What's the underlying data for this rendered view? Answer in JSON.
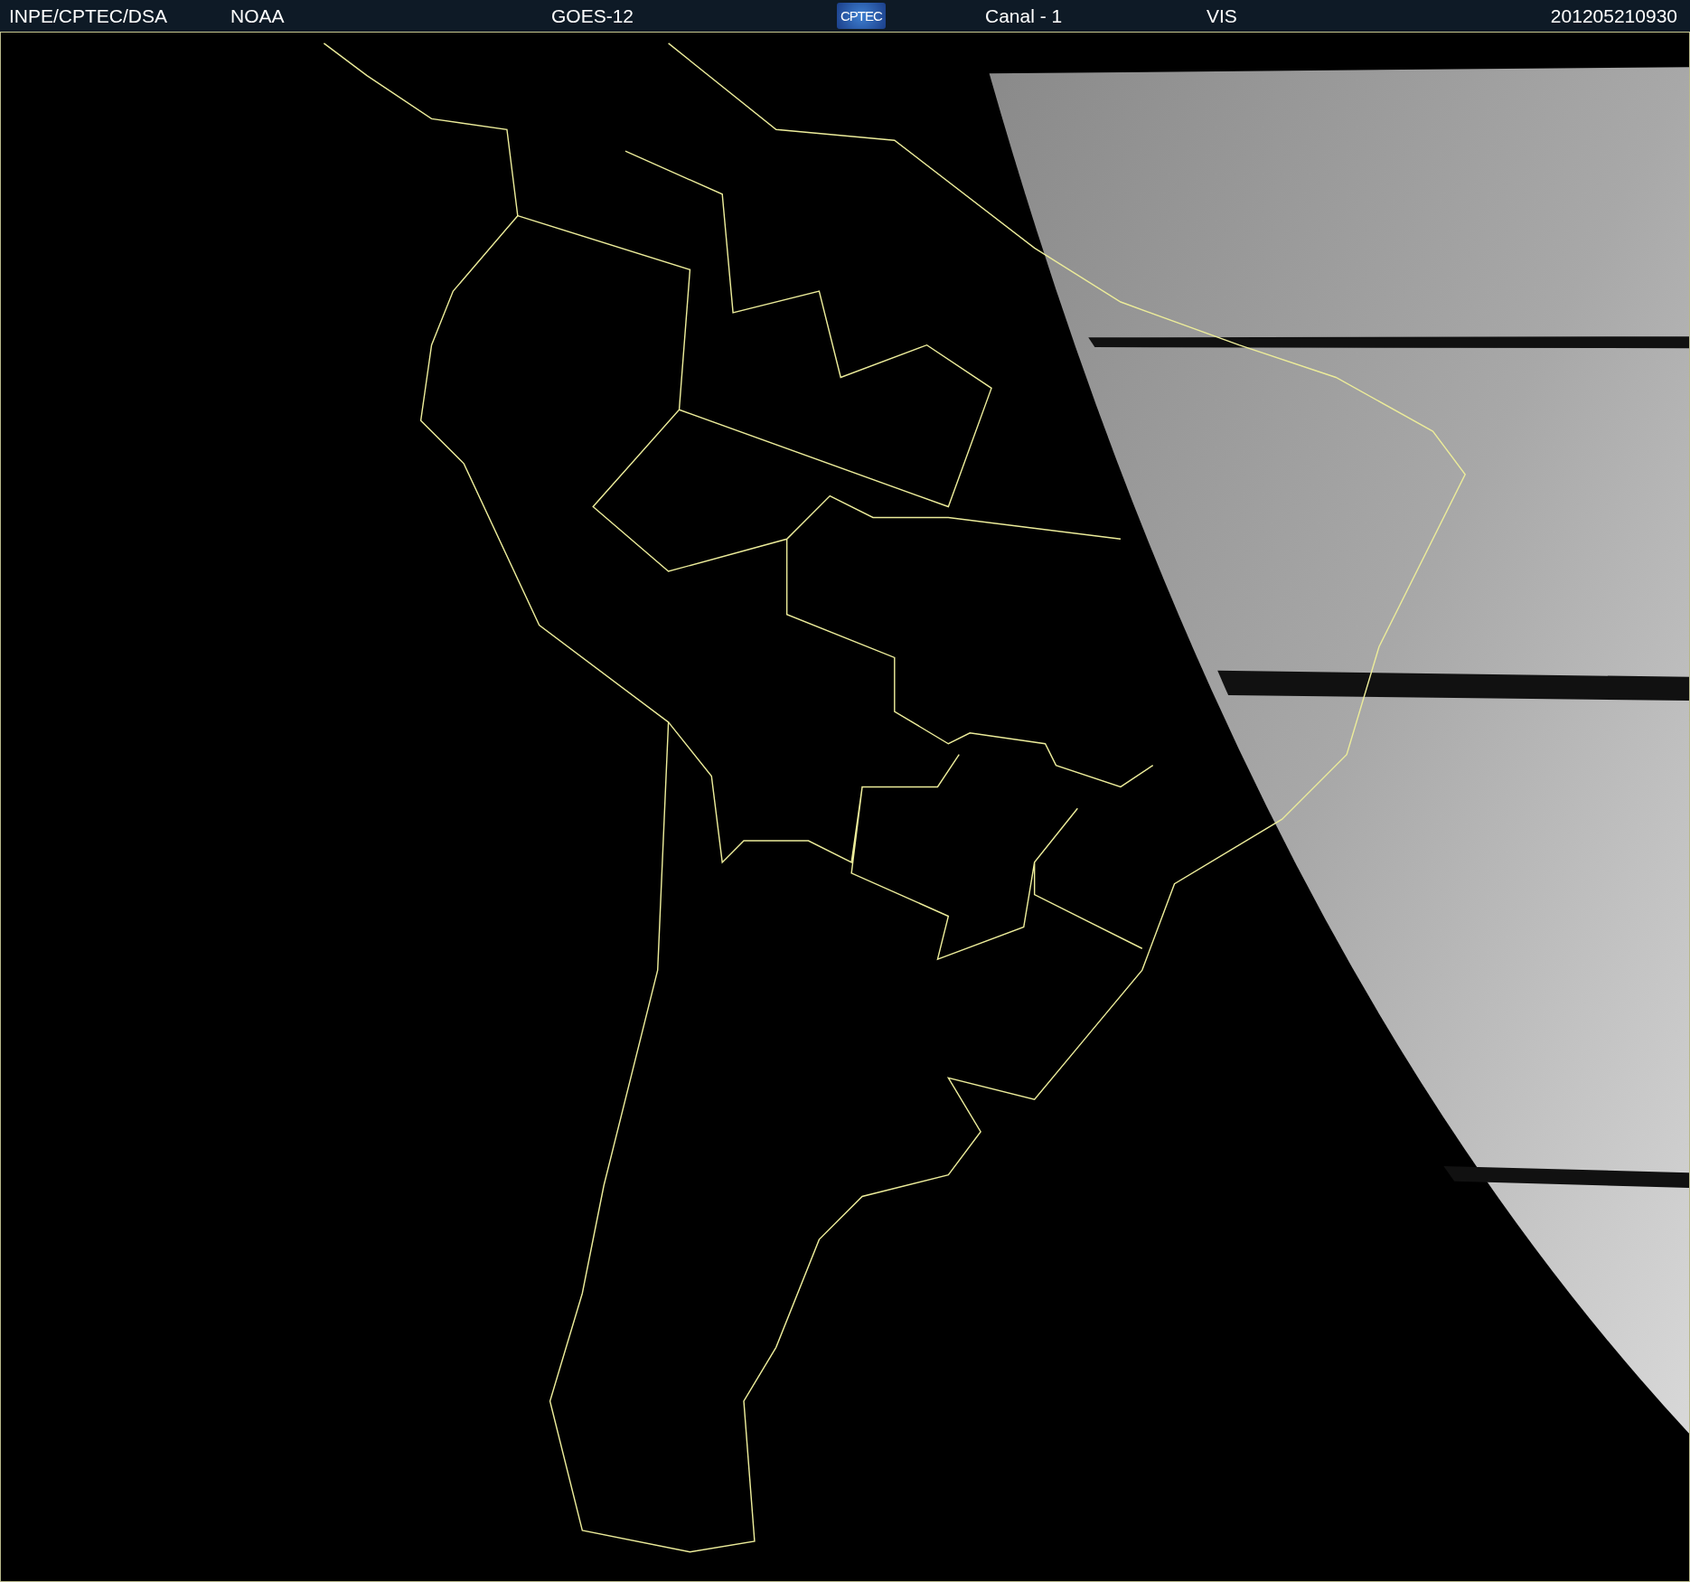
{
  "header": {
    "items": [
      {
        "kind": "text",
        "text": "INPE/CPTEC/DSA"
      },
      {
        "kind": "text",
        "text": "NOAA"
      },
      {
        "kind": "text",
        "text": "GOES-12"
      },
      {
        "kind": "logo",
        "text": "CPTEC"
      },
      {
        "kind": "text",
        "text": "Canal - 1"
      },
      {
        "kind": "text",
        "text": "VIS"
      },
      {
        "kind": "text",
        "text": "201205210930"
      }
    ]
  }
}
